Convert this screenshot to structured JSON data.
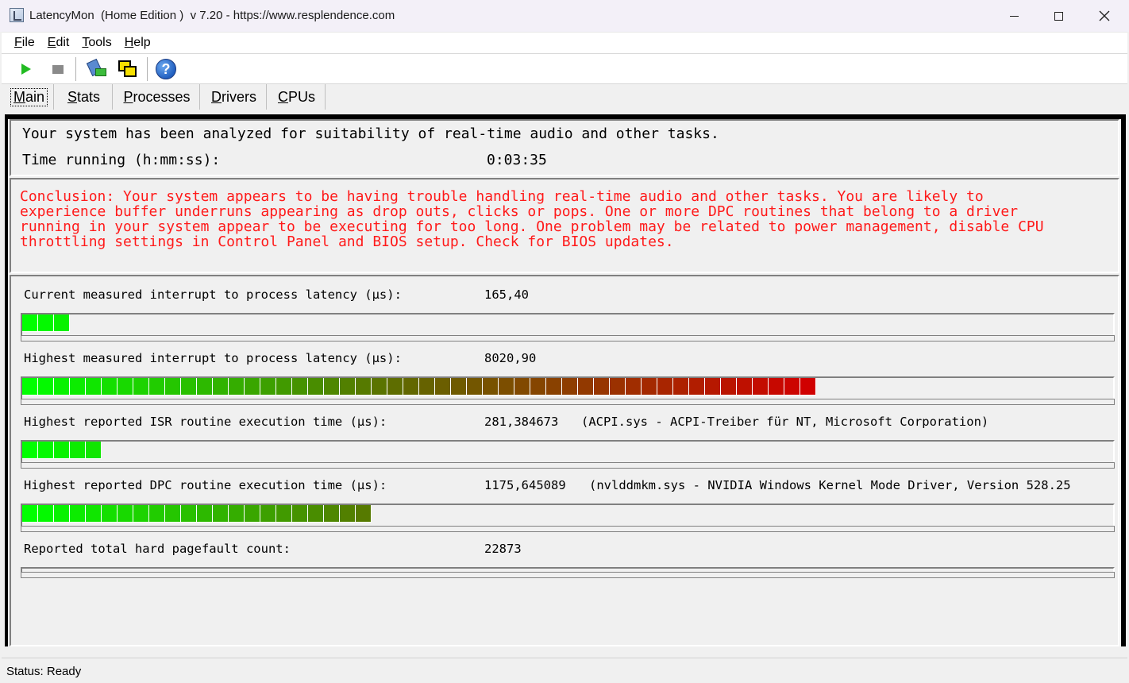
{
  "window": {
    "title": "LatencyMon  (Home Edition )  v 7.20 - https://www.resplendence.com"
  },
  "menu": {
    "items": [
      {
        "prefix": "",
        "accel": "F",
        "rest": "ile"
      },
      {
        "prefix": "",
        "accel": "E",
        "rest": "dit"
      },
      {
        "prefix": "",
        "accel": "T",
        "rest": "ools"
      },
      {
        "prefix": "",
        "accel": "H",
        "rest": "elp"
      }
    ]
  },
  "toolbar": {
    "icons": [
      "play-icon",
      "stop-icon",
      "analyze-icon",
      "windows-icon",
      "help-icon"
    ],
    "help_glyph": "?"
  },
  "tabs": [
    {
      "accel": "M",
      "rest": "ain",
      "active": true
    },
    {
      "accel": "S",
      "rest": "tats",
      "active": false
    },
    {
      "accel": "P",
      "rest": "rocesses",
      "active": false
    },
    {
      "accel": "D",
      "rest": "rivers",
      "active": false
    },
    {
      "accel": "C",
      "rest": "PUs",
      "active": false
    }
  ],
  "main": {
    "analysis_text": "Your system has been analyzed for suitability of real-time audio and other tasks.",
    "time_label": "Time running (h:mm:ss):",
    "time_value": "0:03:35",
    "conclusion": "Conclusion: Your system appears to be having trouble handling real-time audio and other tasks. You are likely to\nexperience buffer underruns appearing as drop outs, clicks or pops. One or more DPC routines that belong to a driver\nrunning in your system appear to be executing for too long. One problem may be related to power management, disable CPU\nthrottling settings in Control Panel and BIOS setup. Check for BIOS updates.",
    "metrics": [
      {
        "label": "Current measured interrupt to process latency (µs):",
        "value": "165,40",
        "detail": "",
        "cells": 3
      },
      {
        "label": "Highest measured interrupt to process latency (µs):",
        "value": "8020,90",
        "detail": "",
        "cells": 50
      },
      {
        "label": "Highest reported ISR routine execution time (µs):",
        "value": "281,384673",
        "detail": "(ACPI.sys - ACPI-Treiber für NT, Microsoft Corporation)",
        "cells": 5
      },
      {
        "label": "Highest reported DPC routine execution time (µs):",
        "value": "1175,645089",
        "detail": "(nvlddmkm.sys - NVIDIA Windows Kernel Mode Driver, Version 528.25",
        "cells": 22
      },
      {
        "label": "Reported total hard pagefault count:",
        "value": "22873",
        "detail": "",
        "cells": 0
      }
    ],
    "gauge_total_cells": 50,
    "gauge_colors": {
      "low": "#00ff00",
      "high": "#d00000"
    }
  },
  "status": {
    "text": "Status: Ready"
  }
}
